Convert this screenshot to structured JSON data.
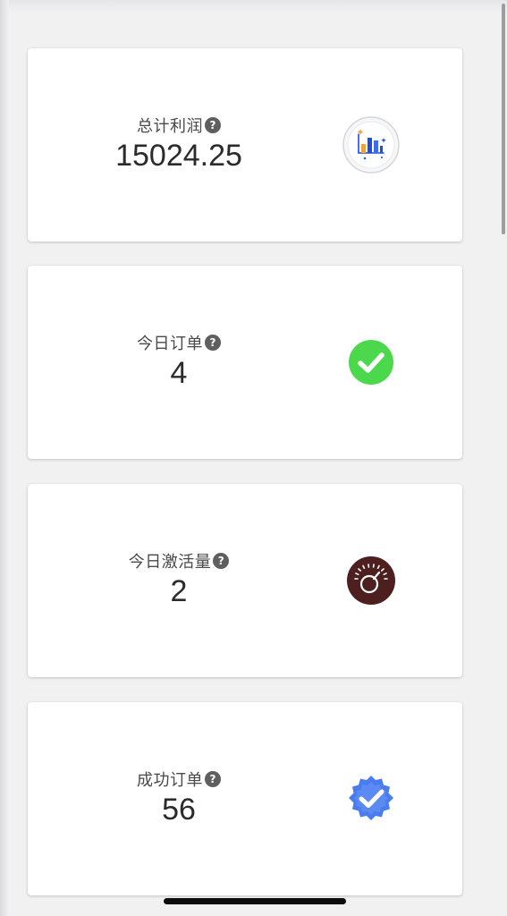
{
  "cards": [
    {
      "label": "总计利润",
      "value": "15024.25",
      "icon": "bar-chart-icon",
      "help_glyph": "?"
    },
    {
      "label": "今日订单",
      "value": "4",
      "icon": "check-circle-icon",
      "help_glyph": "?"
    },
    {
      "label": "今日激活量",
      "value": "2",
      "icon": "gauge-icon",
      "help_glyph": "?"
    },
    {
      "label": "成功订单",
      "value": "56",
      "icon": "verified-badge-icon",
      "help_glyph": "?"
    }
  ],
  "colors": {
    "background": "#f1f1f2",
    "card": "#ffffff",
    "check_green": "#4cd84c",
    "gauge_brown": "#4d1f1f",
    "badge_blue": "#4a7cf0",
    "chart_blue": "#1e4fd8",
    "chart_orange": "#f4a23a"
  }
}
